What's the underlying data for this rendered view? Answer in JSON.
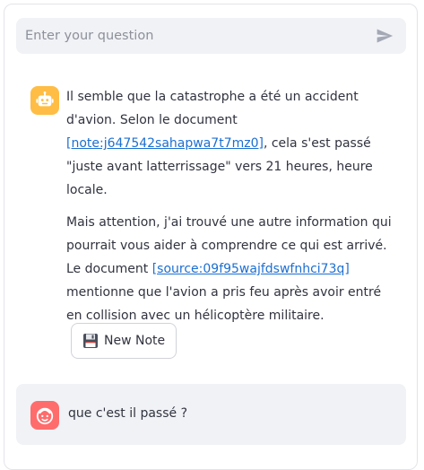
{
  "ask": {
    "placeholder": "Enter your question",
    "send_icon": "send-icon"
  },
  "bot_message": {
    "avatar_icon": "bot-icon",
    "paragraph_1": {
      "before": "Il semble que la catastrophe a été un accident d'avion. Selon le document ",
      "ref": "[note:j647542sahapwa7t7mz0]",
      "after": ", cela s'est passé \"juste avant latterrissage\" vers 21 heures, heure locale."
    },
    "paragraph_2": {
      "before": "Mais attention, j'ai trouvé une autre information qui pourrait vous aider à comprendre ce qui est arrivé. Le document ",
      "ref": "[source:09f95wajfdswfnhci73q]",
      "after": " mentionne que l'avion a pris feu après avoir entré en collision avec un hélicoptère militaire."
    },
    "new_note_label": "New Note",
    "new_note_icon": "floppy-disk-icon"
  },
  "user_message": {
    "avatar_icon": "user-face-icon",
    "text": "que c'est il passé ?"
  },
  "colors": {
    "bot_avatar": "#ffbd45",
    "user_avatar": "#ff6c6c",
    "link": "#1c6fd1",
    "input_bg": "#f0f2f6"
  }
}
